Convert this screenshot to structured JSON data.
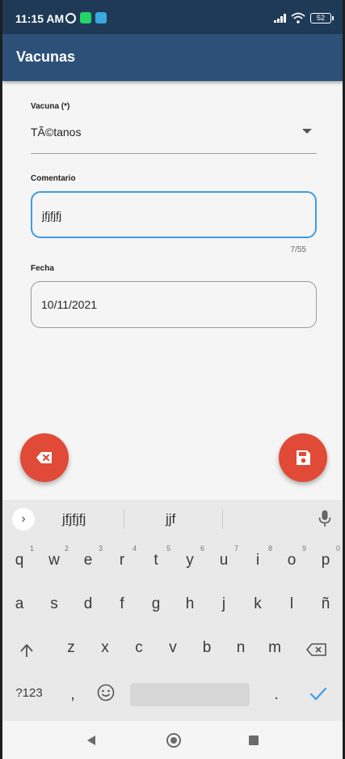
{
  "status_bar": {
    "time": "11:15 AM",
    "battery": "52",
    "icons_left": [
      "alarm-icon",
      "whatsapp-icon",
      "telegram-icon"
    ],
    "icons_right": [
      "signal-icon",
      "wifi-icon",
      "battery-icon"
    ]
  },
  "app_bar": {
    "title": "Vacunas",
    "color": "#2c5078"
  },
  "form": {
    "vacuna": {
      "label": "Vacuna (*)",
      "value": "TÃ©tanos"
    },
    "comentario": {
      "label": "Comentario",
      "value": "jfjfjfj",
      "counter": "7/55"
    },
    "fecha": {
      "label": "Fecha",
      "value": "10/11/2021"
    }
  },
  "fabs": {
    "clear_icon": "backspace-icon",
    "save_icon": "save-icon",
    "color": "#e04a37"
  },
  "keyboard": {
    "suggestions": [
      "jfjfjfj",
      "jjf"
    ],
    "row1": [
      {
        "k": "q",
        "n": "1"
      },
      {
        "k": "w",
        "n": "2"
      },
      {
        "k": "e",
        "n": "3"
      },
      {
        "k": "r",
        "n": "4"
      },
      {
        "k": "t",
        "n": "5"
      },
      {
        "k": "y",
        "n": "6"
      },
      {
        "k": "u",
        "n": "7"
      },
      {
        "k": "i",
        "n": "8"
      },
      {
        "k": "o",
        "n": "9"
      },
      {
        "k": "p",
        "n": "0"
      }
    ],
    "row2": [
      "a",
      "s",
      "d",
      "f",
      "g",
      "h",
      "j",
      "k",
      "l",
      "ñ"
    ],
    "row3": [
      "z",
      "x",
      "c",
      "v",
      "b",
      "n",
      "m"
    ],
    "symbols_key": "?123",
    "comma_key": ",",
    "period_key": ".",
    "accent_color": "#3f9be4"
  }
}
